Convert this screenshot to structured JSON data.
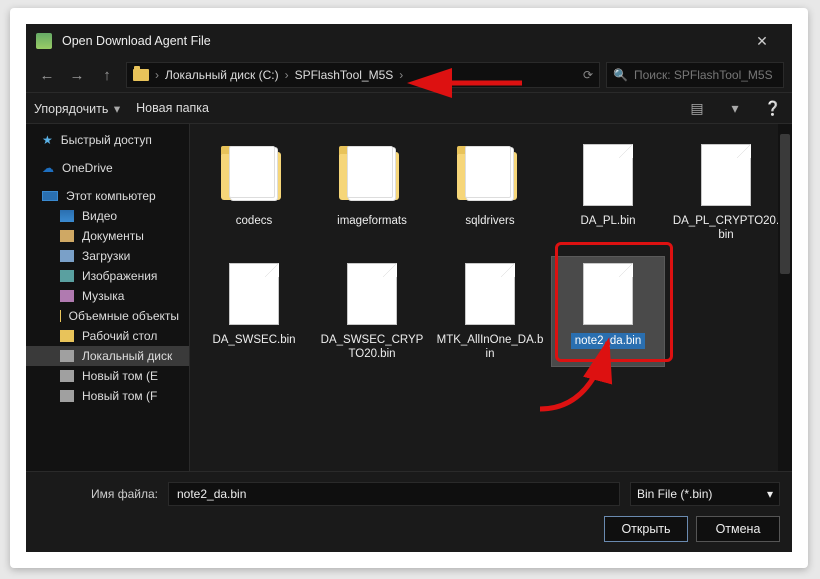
{
  "title": "Open Download Agent File",
  "breadcrumb": {
    "drive": "Локальный диск (C:)",
    "folder": "SPFlashTool_M5S"
  },
  "search": {
    "placeholder": "Поиск: SPFlashTool_M5S"
  },
  "toolbar": {
    "organize": "Упорядочить",
    "newfolder": "Новая папка"
  },
  "sidebar": {
    "quick": "Быстрый доступ",
    "onedrive": "OneDrive",
    "thispc": "Этот компьютер",
    "video": "Видео",
    "documents": "Документы",
    "downloads": "Загрузки",
    "pictures": "Изображения",
    "music": "Музыка",
    "objects3d": "Объемные объекты",
    "desktop": "Рабочий стол",
    "localdisk": "Локальный диск",
    "newvol_e": "Новый том (E",
    "newvol_f": "Новый том (F"
  },
  "items": [
    {
      "type": "folder",
      "label": "codecs"
    },
    {
      "type": "folder",
      "label": "imageformats"
    },
    {
      "type": "folder",
      "label": "sqldrivers"
    },
    {
      "type": "file",
      "label": "DA_PL.bin"
    },
    {
      "type": "file",
      "label": "DA_PL_CRYPTO20.bin"
    },
    {
      "type": "file",
      "label": "DA_SWSEC.bin"
    },
    {
      "type": "file",
      "label": "DA_SWSEC_CRYPTO20.bin"
    },
    {
      "type": "file",
      "label": "MTK_AllInOne_DA.bin"
    },
    {
      "type": "file",
      "label": "note2_da.bin",
      "selected": true
    }
  ],
  "footer": {
    "filename_label": "Имя файла:",
    "filename_value": "note2_da.bin",
    "filter": "Bin File (*.bin)",
    "open": "Открыть",
    "cancel": "Отмена"
  }
}
